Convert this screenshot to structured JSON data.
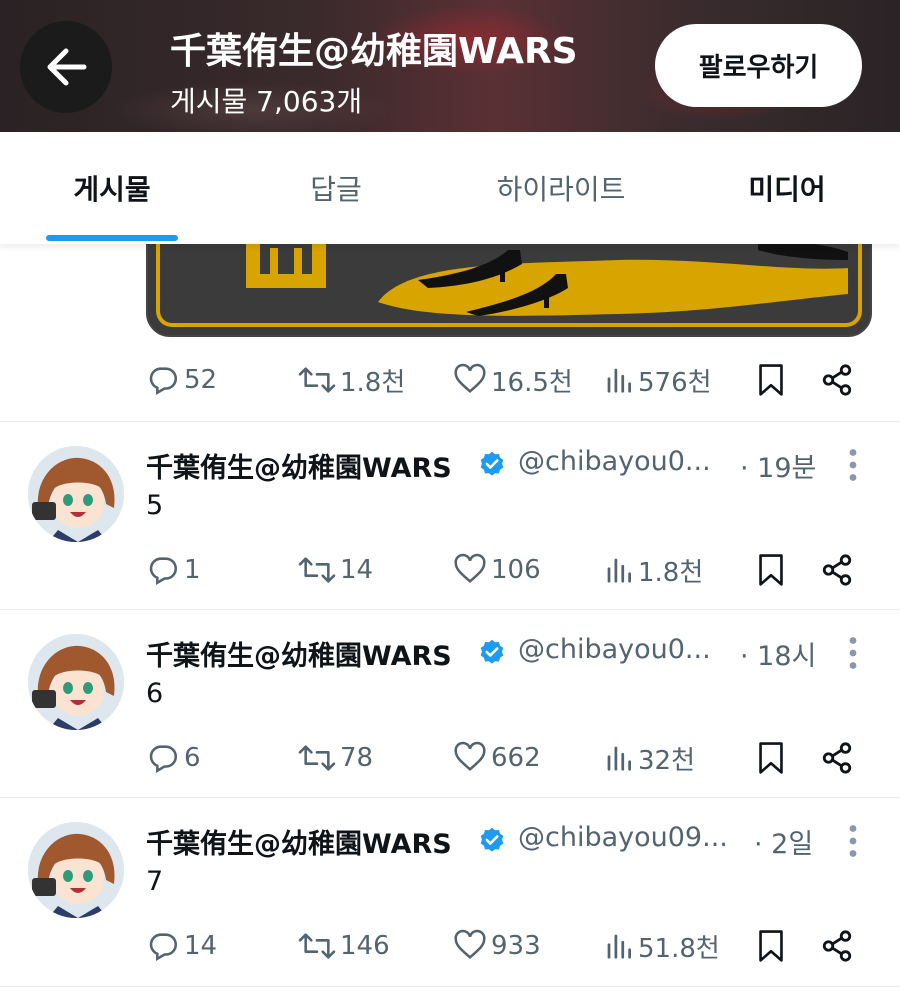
{
  "header": {
    "title": "千葉侑生@幼稚園WARS",
    "post_count": "게시물 7,063개",
    "follow_label": "팔로우하기"
  },
  "tabs": [
    {
      "label": "게시물",
      "active": true
    },
    {
      "label": "답글",
      "active": false
    },
    {
      "label": "하이라이트",
      "active": false
    },
    {
      "label": "미디어",
      "active": false
    }
  ],
  "pinned_actions": {
    "replies": "52",
    "reposts": "1.8천",
    "likes": "16.5천",
    "views": "576천"
  },
  "posts": [
    {
      "name": "千葉侑生@幼稚園WARS",
      "handle": "@chibayou0...",
      "time": "· 19분",
      "body": "5",
      "replies": "1",
      "reposts": "14",
      "likes": "106",
      "views": "1.8천"
    },
    {
      "name": "千葉侑生@幼稚園WARS",
      "handle": "@chibayou0...",
      "time": "· 18시",
      "body": "6",
      "replies": "6",
      "reposts": "78",
      "likes": "662",
      "views": "32천"
    },
    {
      "name": "千葉侑生@幼稚園WARS",
      "handle": "@chibayou09...",
      "time": "· 2일",
      "body": "7",
      "replies": "14",
      "reposts": "146",
      "likes": "933",
      "views": "51.8천"
    }
  ],
  "colors": {
    "accent": "#1d9bf0",
    "muted": "#536471",
    "verified": "#1d9bf0"
  }
}
